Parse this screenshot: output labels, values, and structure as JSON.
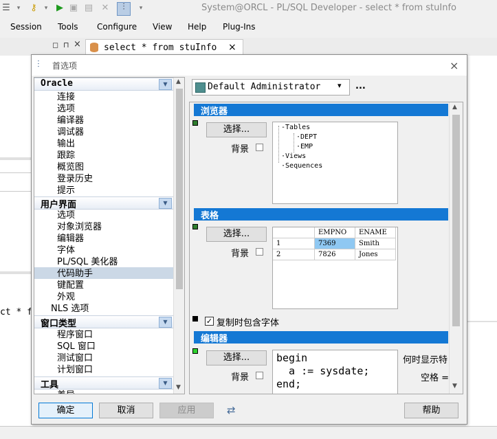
{
  "ide": {
    "title": "System@ORCL - PL/SQL Developer - select * from stuInfo",
    "menus": [
      "Session",
      "Tools",
      "Configure",
      "View",
      "Help",
      "Plug-Ins"
    ],
    "doc_tab": "select * from stuInfo",
    "left_text": "ct * f"
  },
  "dialog": {
    "title": "首选项",
    "tree": {
      "sections": [
        {
          "label": "Oracle",
          "items": [
            "连接",
            "选项",
            "编译器",
            "调试器",
            "输出",
            "跟踪",
            "概览图",
            "登录历史",
            "提示"
          ]
        },
        {
          "label": "用户界面",
          "items": [
            "选项",
            "对象浏览器",
            "编辑器",
            "字体",
            "PL/SQL 美化器",
            "代码助手",
            "键配置",
            "外观",
            "NLS 选项"
          ]
        },
        {
          "label": "窗口类型",
          "items": [
            "程序窗口",
            "SQL 窗口",
            "测试窗口",
            "计划窗口"
          ]
        },
        {
          "label": "工具",
          "items": [
            "差异"
          ]
        }
      ],
      "selected": "字体"
    },
    "profile": "Default Administrator",
    "profile_more": "...",
    "browser": {
      "heading": "浏览器",
      "select_btn": "选择...",
      "bg_label": "背景",
      "tree": [
        "Tables",
        "DEPT",
        "EMP",
        "Views",
        "Sequences"
      ]
    },
    "grid": {
      "heading": "表格",
      "select_btn": "选择...",
      "bg_label": "背景",
      "columns": [
        "",
        "EMPNO",
        "ENAME"
      ],
      "rows": [
        [
          "1",
          "7369",
          "Smith"
        ],
        [
          "2",
          "7826",
          "Jones"
        ]
      ]
    },
    "copy_font": {
      "label": "复制时包含字体",
      "checked": true
    },
    "editor": {
      "heading": "编辑器",
      "select_btn": "选择...",
      "bg_label": "背景",
      "code": [
        "begin",
        "  a := sysdate;",
        "end;"
      ],
      "show_when": "何时显示特",
      "space": "空格 ="
    },
    "buttons": {
      "ok": "确定",
      "cancel": "取消",
      "apply": "应用",
      "help": "帮助"
    }
  }
}
